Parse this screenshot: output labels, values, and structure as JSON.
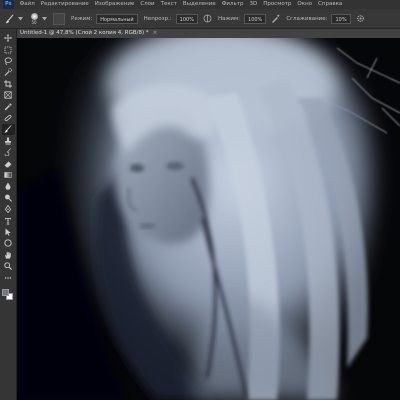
{
  "app": {
    "logo": "Ps"
  },
  "menu": [
    "Файл",
    "Редактирование",
    "Изображение",
    "Слои",
    "Текст",
    "Выделение",
    "Фильтр",
    "3D",
    "Просмотр",
    "Окно",
    "Справка"
  ],
  "options": {
    "brush_size": "50",
    "mode_label": "Режим:",
    "mode_value": "Нормальный",
    "opacity_label": "Непрозр.:",
    "opacity_value": "100%",
    "flow_label": "Нажим:",
    "flow_value": "100%",
    "smoothing_label": "Сглаживание:",
    "smoothing_value": "10%"
  },
  "document": {
    "tab_title": "Untitled-1 @ 47,8% (Слой 2 копия 4, RGB/8) *",
    "close_symbol": "×"
  },
  "toolbar": {
    "active_tool": "brush",
    "tools": [
      "move",
      "marquee",
      "lasso",
      "quick-select",
      "crop",
      "frame",
      "eyedropper",
      "healing",
      "brush",
      "clone-stamp",
      "history-brush",
      "eraser",
      "gradient",
      "blur",
      "dodge",
      "pen",
      "type",
      "path-select",
      "rectangle",
      "hand",
      "zoom",
      "more"
    ],
    "foreground_color": "#6b7790",
    "background_color": "#ffffff"
  }
}
